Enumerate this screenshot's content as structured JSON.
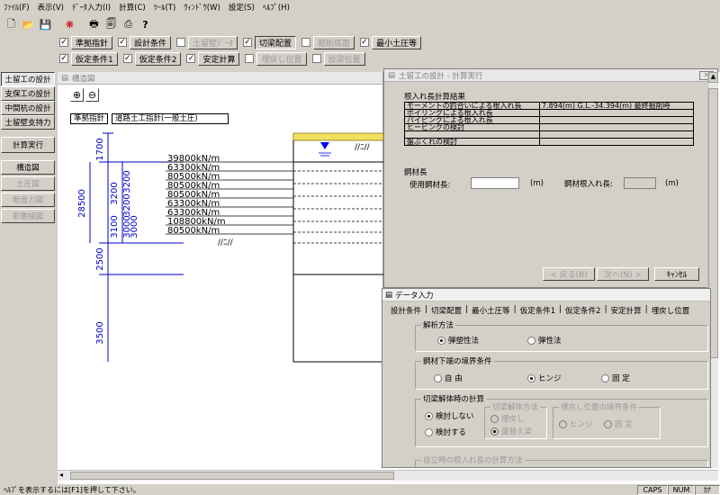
{
  "menubar": [
    "ﾌｧｲﾙ(F)",
    "表示(V)",
    "ﾃﾞｰﾀ入力(I)",
    "計算(C)",
    "ﾂｰﾙ(T)",
    "ｳｨﾝﾄﾞｳ(W)",
    "設定(S)",
    "ﾍﾙﾌﾟ(H)"
  ],
  "toolbar_row1": [
    {
      "label": "準拠指針",
      "checked": true,
      "enabled": true
    },
    {
      "label": "設計条件",
      "checked": true,
      "enabled": true
    },
    {
      "label": "土留壁ﾃﾞｰﾀ",
      "checked": false,
      "enabled": false
    },
    {
      "label": "切梁配置",
      "checked": true,
      "enabled": true
    },
    {
      "label": "掘削底面",
      "checked": false,
      "enabled": false
    },
    {
      "label": "最小土圧等",
      "checked": true,
      "enabled": true
    }
  ],
  "toolbar_row2": [
    {
      "label": "仮定条件1",
      "checked": true,
      "enabled": true
    },
    {
      "label": "仮定条件2",
      "checked": true,
      "enabled": true
    },
    {
      "label": "安定計算",
      "checked": true,
      "enabled": true
    },
    {
      "label": "埋戻し位置",
      "checked": false,
      "enabled": false
    },
    {
      "label": "設梁位置",
      "checked": false,
      "enabled": false
    }
  ],
  "left_panel": {
    "items": [
      "土留工の設計",
      "支保工の設計",
      "中間杭の設計",
      "土留壁支持力"
    ],
    "calc": "計算実行",
    "views": [
      "構造図",
      "土圧図",
      "断面力図",
      "影響線図"
    ]
  },
  "drawing": {
    "title": "構造図",
    "label1": "準拠指針",
    "label2": "道路土工指針(一般土圧)",
    "dims": [
      "1700",
      "3200",
      "3200",
      "3200",
      "28500",
      "3100",
      "3000",
      "3000",
      "2500",
      "3500"
    ],
    "loads": [
      "39800kN/m",
      "63300kN/m",
      "80500kN/m",
      "80500kN/m",
      "80500kN/m",
      "63300kN/m",
      "63300kN/m",
      "108800kN/m",
      "80500kN/m"
    ]
  },
  "calc_window": {
    "title": "土留工の設計 - 計算実行",
    "section1": "根入れ長計算結果",
    "rows": [
      {
        "label": "モーメントの釣合いによる根入れ長",
        "value": "7.894(m)  G.L.-34.394(m) 最終掘削時"
      },
      {
        "label": "ボイリングによる根入れ長",
        "value": ""
      },
      {
        "label": "パイピングによる根入れ長",
        "value": ""
      },
      {
        "label": "ヒービングの検討",
        "value": ""
      },
      {
        "label": "",
        "value": ""
      },
      {
        "label": "盤ぶくれの検討",
        "value": ""
      }
    ],
    "section2": "鋼材長",
    "use_len_label": "使用鋼材長:",
    "unit": "(m)",
    "embed_label": "鋼材根入れ長:",
    "btn_back": "< 戻る(B)",
    "btn_next": "次へ(N) >",
    "btn_cancel": "ｷｬﾝｾﾙ"
  },
  "data_window": {
    "title": "データ入力",
    "tabs": [
      "設計条件",
      "切梁配置",
      "最小土圧等",
      "仮定条件1",
      "仮定条件2",
      "安定計算",
      "埋戻し位置"
    ],
    "group1": {
      "label": "解析方法",
      "options": [
        "弾塑性法",
        "弾性法"
      ],
      "selected": 0
    },
    "group2": {
      "label": "鋼材下端の境界条件",
      "options": [
        "自 由",
        "ヒンジ",
        "固 定"
      ],
      "selected": 1
    },
    "group3": {
      "label": "切梁解体時の計算",
      "options": [
        "検討しない",
        "検討する"
      ],
      "selected": 0,
      "sub1": {
        "label": "切梁解体方法",
        "options": [
          "埋戻し",
          "盛替え梁"
        ],
        "selected": 1
      },
      "sub2": {
        "label": "埋戻し位置の境界条件",
        "options": [
          "ヒンジ",
          "固 定"
        ]
      }
    },
    "group4": {
      "label": "自立時の根入れ長の計算方法"
    }
  },
  "statusbar": {
    "help": "ﾍﾙﾌﾟを表示するには[F1]を押して下さい。",
    "caps": "CAPS",
    "num": "NUM",
    "kana": "ｶﾅ"
  }
}
